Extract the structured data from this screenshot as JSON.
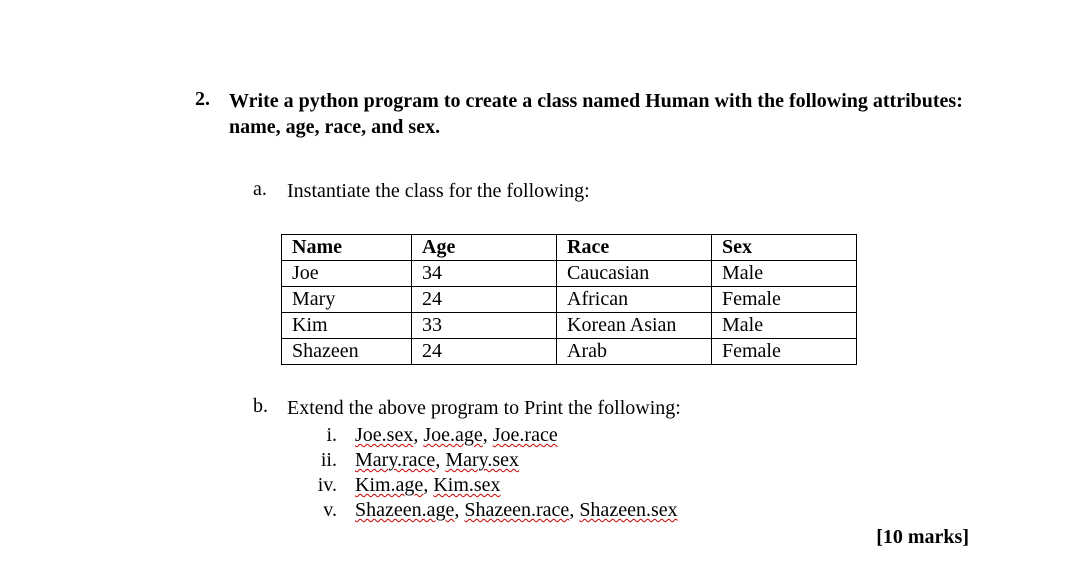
{
  "question": {
    "number": "2.",
    "prompt": "Write a python program to create a class named Human with the following attributes: name, age, race, and sex."
  },
  "part_a": {
    "label": "a.",
    "text": "Instantiate the class for the following:"
  },
  "table": {
    "headers": [
      "Name",
      "Age",
      "Race",
      "Sex"
    ],
    "rows": [
      [
        "Joe",
        "34",
        "Caucasian",
        "Male"
      ],
      [
        "Mary",
        "24",
        "African",
        "Female"
      ],
      [
        "Kim",
        "33",
        "Korean Asian",
        "Male"
      ],
      [
        "Shazeen",
        "24",
        "Arab",
        "Female"
      ]
    ]
  },
  "part_b": {
    "label": "b.",
    "text": "Extend the above program to Print the following:",
    "items": [
      {
        "label": "i.",
        "segments": [
          "Joe.sex",
          "Joe.age",
          "Joe.race"
        ]
      },
      {
        "label": "ii.",
        "segments": [
          "Mary.race",
          "Mary.sex"
        ]
      },
      {
        "label": "iv.",
        "segments": [
          "Kim.age",
          "Kim.sex"
        ]
      },
      {
        "label": "v.",
        "segments": [
          "Shazeen.age",
          "Shazeen.race",
          "Shazeen.sex"
        ]
      }
    ]
  },
  "marks": "[10 marks]"
}
